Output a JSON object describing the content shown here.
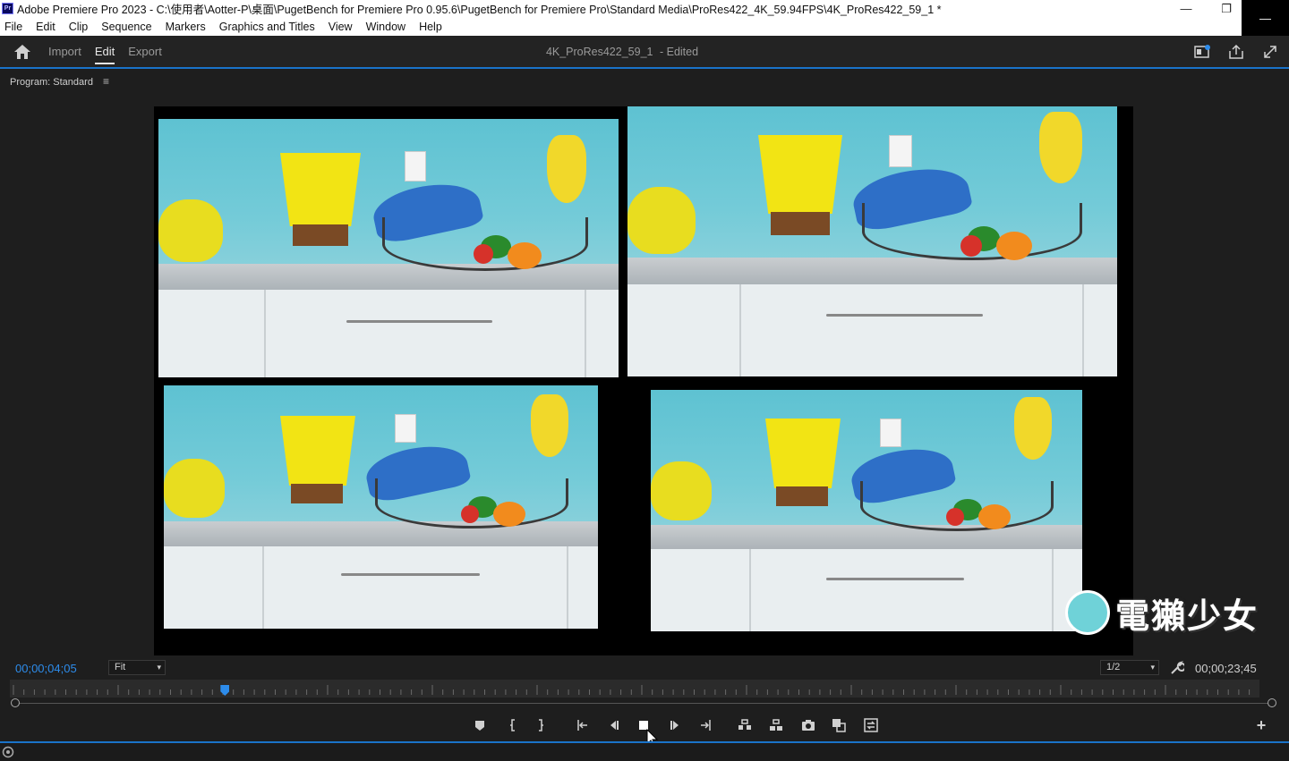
{
  "window": {
    "title": "Adobe Premiere Pro 2023 - C:\\使用者\\Aotter-P\\桌面\\PugetBench for Premiere Pro 0.95.6\\PugetBench for Premiere Pro\\Standard Media\\ProRes422_4K_59.94FPS\\4K_ProRes422_59_1 *",
    "app_icon_label": "Pr",
    "minimize": "—",
    "restore": "❐",
    "close": "—"
  },
  "menu": [
    "File",
    "Edit",
    "Clip",
    "Sequence",
    "Markers",
    "Graphics and Titles",
    "View",
    "Window",
    "Help"
  ],
  "header": {
    "tabs": [
      {
        "label": "Import",
        "active": false
      },
      {
        "label": "Edit",
        "active": true
      },
      {
        "label": "Export",
        "active": false
      }
    ],
    "project_name": "4K_ProRes422_59_1",
    "project_status": "- Edited"
  },
  "program_monitor": {
    "title": "Program: Standard",
    "menu_icon": "≡",
    "current_timecode": "00;00;04;05",
    "fit_option": "Fit",
    "resolution_option": "1/2",
    "duration_timecode": "00;00;23;45",
    "playhead_fraction": 0.17
  },
  "watermark": {
    "text": "電獺少女"
  },
  "colors": {
    "accent": "#2d8ceb",
    "timecode": "#2d8ceb",
    "panel_bg": "#1e1e1e",
    "header_bg": "#232323"
  },
  "transport": {
    "add_button": "+"
  }
}
